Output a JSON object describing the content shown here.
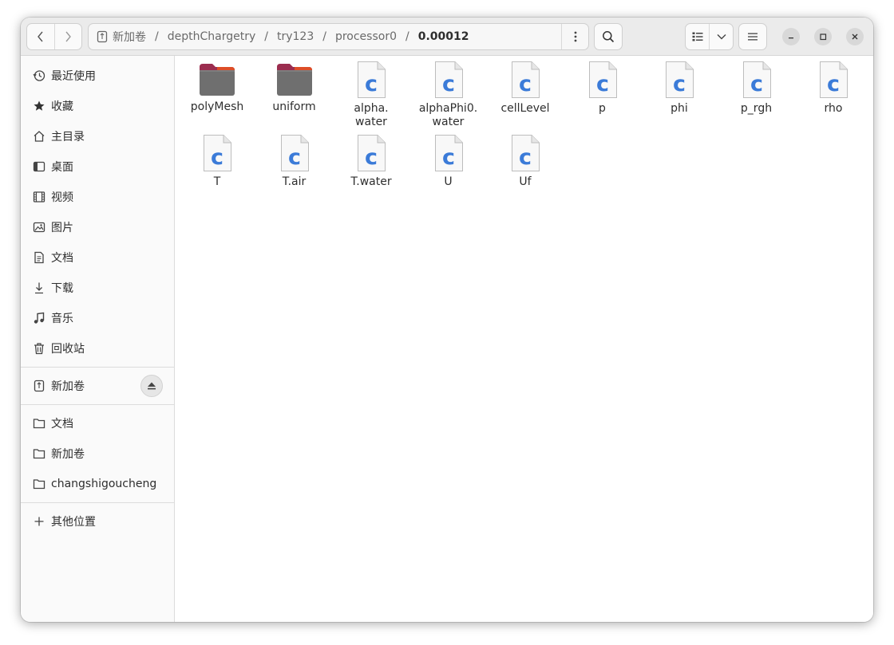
{
  "path": {
    "crumbs": [
      "新加卷",
      "depthChargetry",
      "try123",
      "processor0"
    ],
    "current": "0.00012"
  },
  "sidebar": {
    "places": [
      {
        "label": "最近使用",
        "icon": "clock-icon"
      },
      {
        "label": "收藏",
        "icon": "star-icon"
      },
      {
        "label": "主目录",
        "icon": "home-icon"
      },
      {
        "label": "桌面",
        "icon": "desktop-icon"
      },
      {
        "label": "视频",
        "icon": "film-icon"
      },
      {
        "label": "图片",
        "icon": "image-icon"
      },
      {
        "label": "文档",
        "icon": "document-icon"
      },
      {
        "label": "下载",
        "icon": "download-icon"
      },
      {
        "label": "音乐",
        "icon": "music-icon"
      },
      {
        "label": "回收站",
        "icon": "trash-icon"
      }
    ],
    "device": {
      "label": "新加卷",
      "icon": "drive-icon"
    },
    "bookmarks": [
      {
        "label": "文档",
        "icon": "folder-icon"
      },
      {
        "label": "新加卷",
        "icon": "folder-icon"
      },
      {
        "label": "changshigoucheng",
        "icon": "folder-icon"
      }
    ],
    "other_locations": "其他位置"
  },
  "files": [
    {
      "name": "polyMesh",
      "type": "folder"
    },
    {
      "name": "uniform",
      "type": "folder"
    },
    {
      "name": "alpha.\nwater",
      "type": "c-file"
    },
    {
      "name": "alphaPhi0.\nwater",
      "type": "c-file"
    },
    {
      "name": "cellLevel",
      "type": "c-file"
    },
    {
      "name": "p",
      "type": "c-file"
    },
    {
      "name": "phi",
      "type": "c-file"
    },
    {
      "name": "p_rgh",
      "type": "c-file"
    },
    {
      "name": "rho",
      "type": "c-file"
    },
    {
      "name": "T",
      "type": "c-file"
    },
    {
      "name": "T.air",
      "type": "c-file"
    },
    {
      "name": "T.water",
      "type": "c-file"
    },
    {
      "name": "U",
      "type": "c-file"
    },
    {
      "name": "Uf",
      "type": "c-file"
    }
  ],
  "colors": {
    "folder_body": "#6f6f6f",
    "folder_tab": "#9b2d4f",
    "folder_accent": "#e95420",
    "c_letter": "#3b7bd8"
  }
}
